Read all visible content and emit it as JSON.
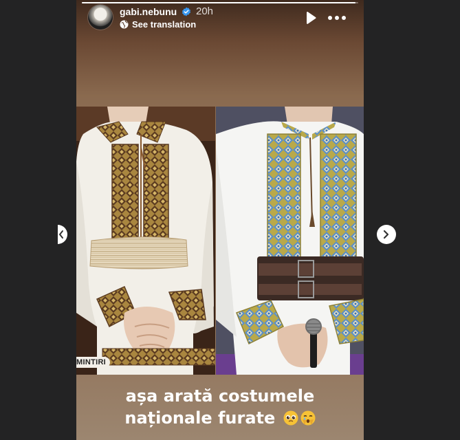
{
  "story": {
    "username": "gabi.nebunu",
    "time_ago": "20h",
    "translate_label": "See translation",
    "progress": 0.99,
    "badge_text": "MINTIRI",
    "caption_line1": "așa arată costumele",
    "caption_line2": "naționale furate"
  },
  "icons": {
    "verified": "verified-badge-icon",
    "globe": "globe-icon",
    "play": "play-icon",
    "more": "more-horizontal-icon",
    "prev": "chevron-left-icon",
    "next": "chevron-right-icon",
    "emoji_1": "pleading-face-emoji",
    "emoji_2": "face-holding-back-tears-emoji"
  },
  "colors": {
    "page_bg": "#232324",
    "verified_blue": "#3897f0",
    "embroidery_gold": "#b0913a",
    "embroidery_blue": "#5b8fc9"
  }
}
